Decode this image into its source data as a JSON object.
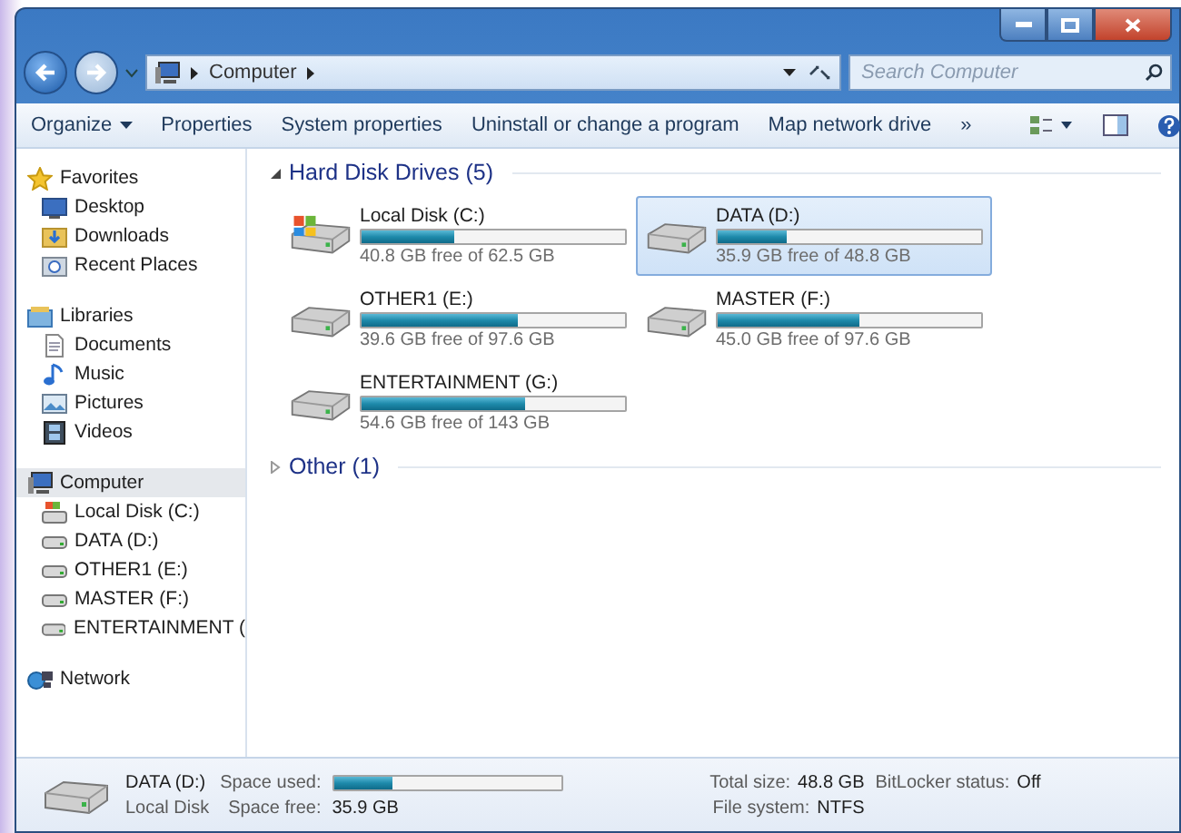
{
  "address_bar": {
    "path": [
      "Computer"
    ],
    "search_placeholder": "Search Computer"
  },
  "toolbar": {
    "items": [
      {
        "label": "Organize",
        "dropdown": true
      },
      {
        "label": "Properties",
        "dropdown": false
      },
      {
        "label": "System properties",
        "dropdown": false
      },
      {
        "label": "Uninstall or change a program",
        "dropdown": false
      },
      {
        "label": "Map network drive",
        "dropdown": false
      },
      {
        "label": "»",
        "dropdown": false
      }
    ]
  },
  "sidebar": {
    "groups": [
      {
        "label": "Favorites",
        "kind": "star",
        "selected": false,
        "children": [
          {
            "label": "Desktop",
            "kind": "desktop",
            "selected": false
          },
          {
            "label": "Downloads",
            "kind": "downloads",
            "selected": false
          },
          {
            "label": "Recent Places",
            "kind": "recent",
            "selected": false
          }
        ]
      },
      {
        "label": "Libraries",
        "kind": "libraries",
        "selected": false,
        "children": [
          {
            "label": "Documents",
            "kind": "document",
            "selected": false
          },
          {
            "label": "Music",
            "kind": "music",
            "selected": false
          },
          {
            "label": "Pictures",
            "kind": "pictures",
            "selected": false
          },
          {
            "label": "Videos",
            "kind": "videos",
            "selected": false
          }
        ]
      },
      {
        "label": "Computer",
        "kind": "computer",
        "selected": true,
        "children": [
          {
            "label": "Local Disk (C:)",
            "kind": "system",
            "selected": false
          },
          {
            "label": "DATA (D:)",
            "kind": "drive",
            "selected": false
          },
          {
            "label": "OTHER1 (E:)",
            "kind": "drive",
            "selected": false
          },
          {
            "label": "MASTER (F:)",
            "kind": "drive",
            "selected": false
          },
          {
            "label": "ENTERTAINMENT (",
            "kind": "drive",
            "selected": false
          }
        ]
      },
      {
        "label": "Network",
        "kind": "network",
        "selected": false
      }
    ]
  },
  "sections": [
    {
      "title": "Hard Disk Drives (5)",
      "expanded": true,
      "drives": [
        {
          "name": "Local Disk (C:)",
          "free": "40.8 GB free of 62.5 GB",
          "level": 0.35,
          "kind": "system",
          "selected": false
        },
        {
          "name": "DATA (D:)",
          "free": "35.9 GB free of 48.8 GB",
          "level": 0.26,
          "kind": "drive",
          "selected": true
        },
        {
          "name": "OTHER1 (E:)",
          "free": "39.6 GB free of 97.6 GB",
          "level": 0.59,
          "kind": "drive",
          "selected": false
        },
        {
          "name": "MASTER (F:)",
          "free": "45.0 GB free of 97.6 GB",
          "level": 0.54,
          "kind": "drive",
          "selected": false
        },
        {
          "name": "ENTERTAINMENT (G:)",
          "free": "54.6 GB free of 143 GB",
          "level": 0.62,
          "kind": "drive",
          "selected": false
        }
      ]
    },
    {
      "title": "Other (1)",
      "expanded": false
    }
  ],
  "details": {
    "name": "DATA (D:)",
    "type": "Local Disk",
    "used_label": "Space used:",
    "level": 0.26,
    "free_label": "Space free:",
    "free_value": "35.9 GB",
    "total_label": "Total size:",
    "total_value": "48.8 GB",
    "fs_label": "File system:",
    "fs_value": "NTFS",
    "bitlocker_label": "BitLocker status:",
    "bitlocker_value": "Off"
  }
}
